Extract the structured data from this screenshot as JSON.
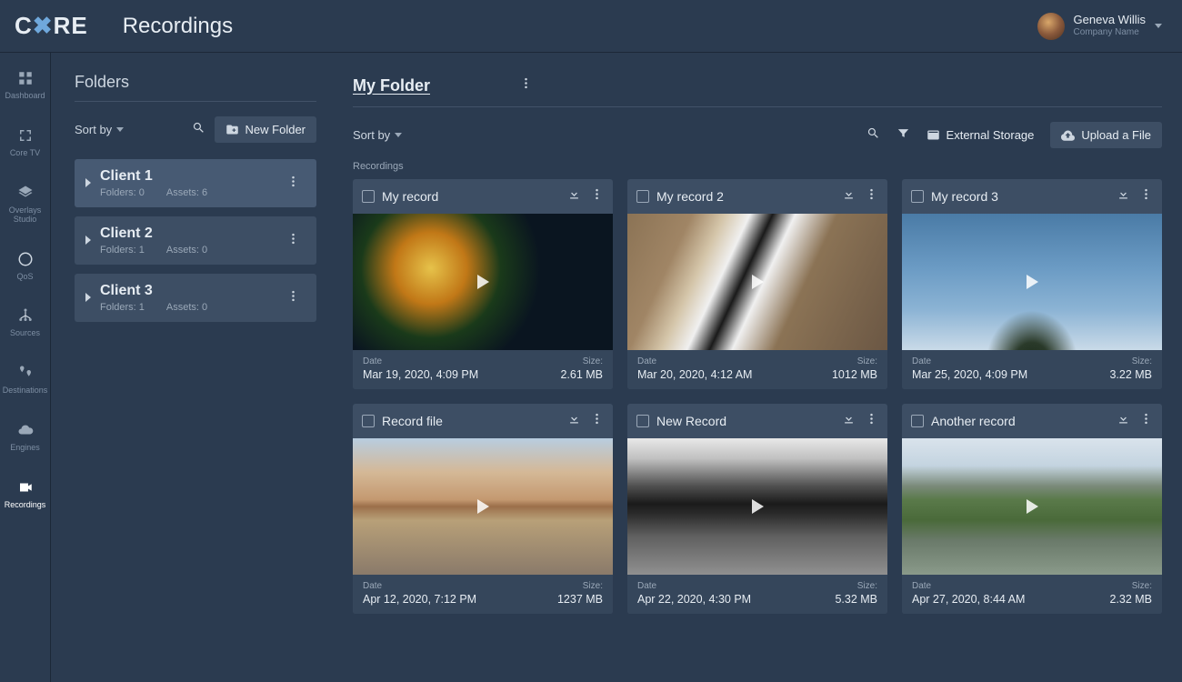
{
  "header": {
    "logo_a": "C",
    "logo_b": "RE",
    "page_title": "Recordings",
    "user_name": "Geneva Willis",
    "user_company": "Company Name"
  },
  "nav": [
    {
      "label": "Dashboard",
      "icon": "grid"
    },
    {
      "label": "Core TV",
      "icon": "expand"
    },
    {
      "label": "Overlays Studio",
      "icon": "layers"
    },
    {
      "label": "QoS",
      "icon": "gauge"
    },
    {
      "label": "Sources",
      "icon": "tree"
    },
    {
      "label": "Destinations",
      "icon": "pins"
    },
    {
      "label": "Engines",
      "icon": "cloud"
    },
    {
      "label": "Recordings",
      "icon": "video",
      "active": true
    }
  ],
  "folders_panel": {
    "heading": "Folders",
    "sort_label": "Sort by",
    "new_folder_label": "New Folder",
    "folders": [
      {
        "name": "Client 1",
        "folders": 0,
        "assets": 6,
        "selected": true
      },
      {
        "name": "Client 2",
        "folders": 1,
        "assets": 0
      },
      {
        "name": "Client 3",
        "folders": 1,
        "assets": 0
      }
    ],
    "folders_prefix": "Folders:",
    "assets_prefix": "Assets:"
  },
  "main": {
    "title": "My Folder",
    "sort_label": "Sort by",
    "external_storage_label": "External Storage",
    "upload_label": "Upload a File",
    "section_label": "Recordings",
    "date_label": "Date",
    "size_label": "Size:",
    "records": [
      {
        "title": "My record",
        "date": "Mar 19, 2020, 4:09 PM",
        "size": "2.61 MB",
        "thumb": "th0"
      },
      {
        "title": "My record 2",
        "date": "Mar 20, 2020, 4:12 AM",
        "size": "1012 MB",
        "thumb": "th1"
      },
      {
        "title": "My record 3",
        "date": "Mar 25, 2020, 4:09 PM",
        "size": "3.22 MB",
        "thumb": "th2"
      },
      {
        "title": "Record file",
        "date": "Apr 12, 2020, 7:12 PM",
        "size": "1237 MB",
        "thumb": "th3"
      },
      {
        "title": "New Record",
        "date": "Apr 22, 2020, 4:30 PM",
        "size": "5.32 MB",
        "thumb": "th4"
      },
      {
        "title": "Another record",
        "date": "Apr 27, 2020, 8:44 AM",
        "size": "2.32 MB",
        "thumb": "th5"
      }
    ]
  }
}
